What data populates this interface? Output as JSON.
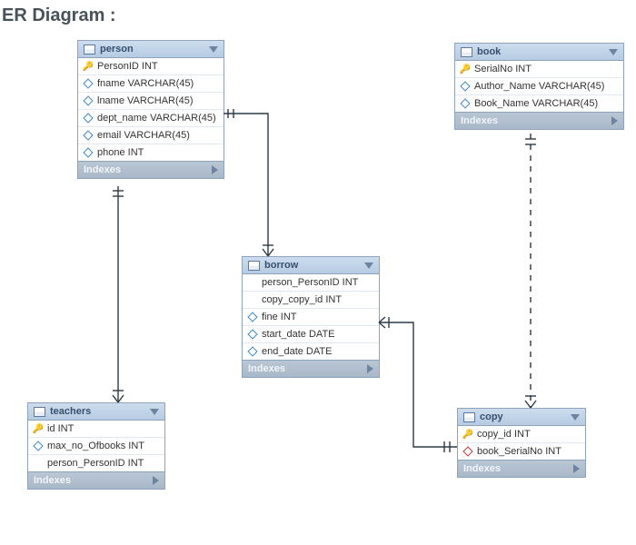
{
  "title": "ER Diagram :",
  "indexes_label": "Indexes",
  "entities": {
    "person": {
      "name": "person",
      "cols": [
        {
          "icon": "key",
          "text": "PersonID INT"
        },
        {
          "icon": "diamond-blue",
          "text": "fname VARCHAR(45)"
        },
        {
          "icon": "diamond-blue",
          "text": "lname VARCHAR(45)"
        },
        {
          "icon": "diamond-blue",
          "text": "dept_name VARCHAR(45)"
        },
        {
          "icon": "diamond-blue",
          "text": "email VARCHAR(45)"
        },
        {
          "icon": "diamond-blue",
          "text": "phone INT"
        }
      ]
    },
    "book": {
      "name": "book",
      "cols": [
        {
          "icon": "key",
          "text": "SerialNo INT"
        },
        {
          "icon": "diamond-blue",
          "text": "Author_Name VARCHAR(45)"
        },
        {
          "icon": "diamond-blue",
          "text": "Book_Name VARCHAR(45)"
        }
      ]
    },
    "borrow": {
      "name": "borrow",
      "cols": [
        {
          "icon": "",
          "text": "person_PersonID INT"
        },
        {
          "icon": "",
          "text": "copy_copy_id INT"
        },
        {
          "icon": "diamond-blue",
          "text": "fine INT"
        },
        {
          "icon": "diamond-blue",
          "text": "start_date DATE"
        },
        {
          "icon": "diamond-blue",
          "text": "end_date DATE"
        }
      ]
    },
    "teachers": {
      "name": "teachers",
      "cols": [
        {
          "icon": "key",
          "text": "id INT"
        },
        {
          "icon": "diamond-blue",
          "text": "max_no_Ofbooks INT"
        },
        {
          "icon": "",
          "text": "person_PersonID INT"
        }
      ]
    },
    "copy": {
      "name": "copy",
      "cols": [
        {
          "icon": "key",
          "text": "copy_id INT"
        },
        {
          "icon": "diamond-red",
          "text": "book_SerialNo INT"
        }
      ]
    }
  }
}
